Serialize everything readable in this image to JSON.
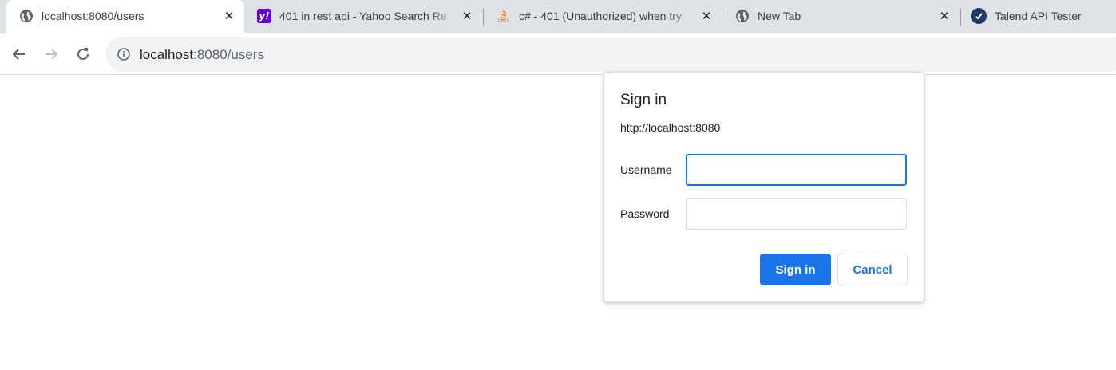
{
  "tabs": [
    {
      "title": "localhost:8080/users",
      "favicon": "globe-icon",
      "active": true
    },
    {
      "title": "401 in rest api - Yahoo Search Re",
      "favicon": "yahoo-icon",
      "favicon_text": "y!",
      "favicon_color": "#6001d2"
    },
    {
      "title": "c# - 401 (Unauthorized) when try",
      "favicon": "stackoverflow-icon",
      "favicon_color": "#f48024"
    },
    {
      "title": "New Tab",
      "favicon": "globe-icon"
    },
    {
      "title": "Talend API Tester",
      "favicon": "talend-check-icon",
      "favicon_color": "#1f3a64"
    }
  ],
  "toolbar": {
    "back_icon": "arrow-left-icon",
    "forward_icon": "arrow-right-icon",
    "reload_icon": "reload-icon",
    "site_info_icon": "info-circle-icon",
    "url_host": "localhost",
    "url_rest": ":8080/users"
  },
  "dialog": {
    "title": "Sign in",
    "origin": "http://localhost:8080",
    "username_label": "Username",
    "username_value": "",
    "password_label": "Password",
    "password_value": "",
    "sign_in_label": "Sign in",
    "cancel_label": "Cancel"
  },
  "colors": {
    "accent": "#1a73e8",
    "tabstrip_bg": "#dee1e6",
    "omnibox_bg": "#f1f3f4"
  }
}
